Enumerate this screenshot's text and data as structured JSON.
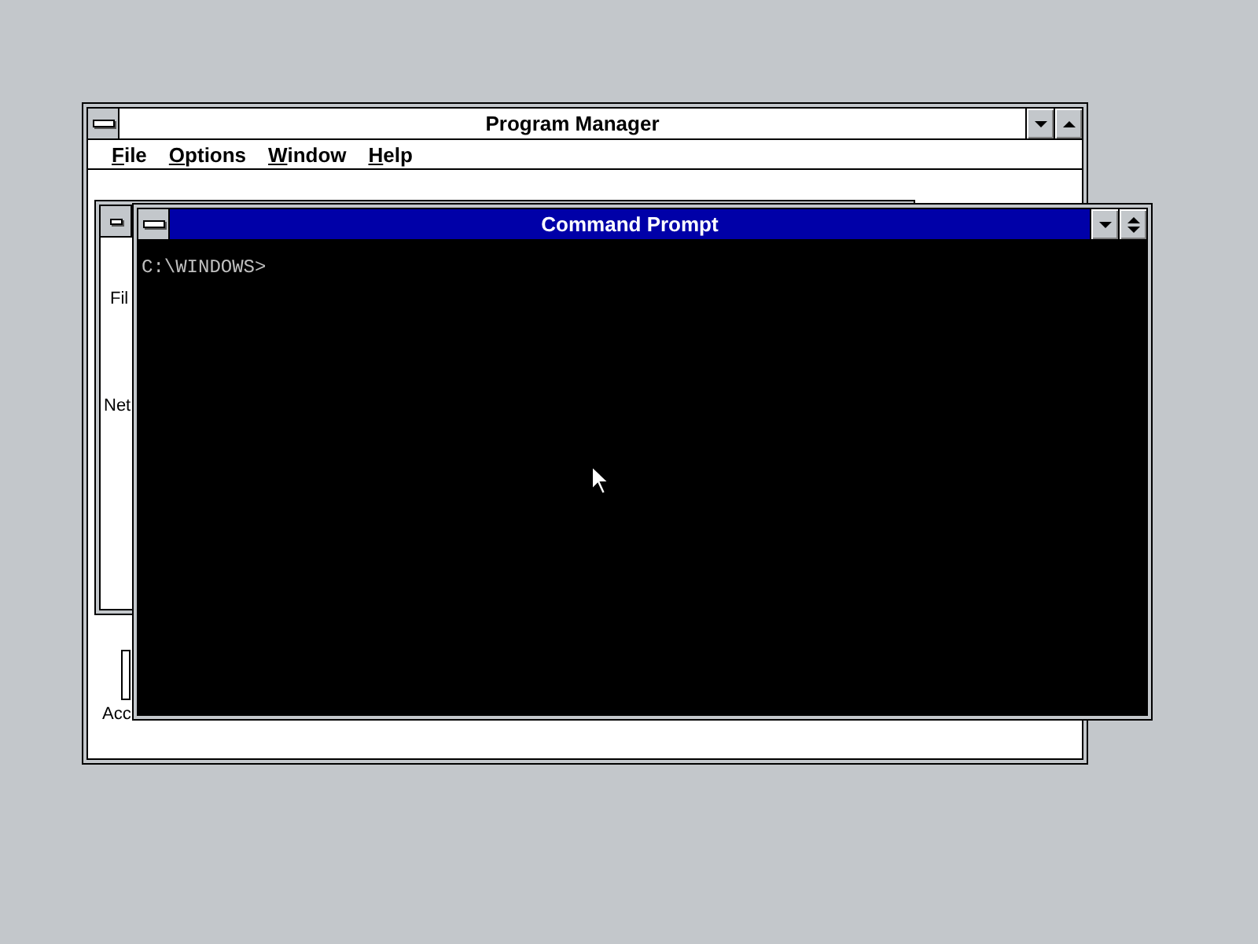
{
  "program_manager": {
    "title": "Program Manager",
    "active": false,
    "menu": [
      {
        "label": "File"
      },
      {
        "label": "Options"
      },
      {
        "label": "Window"
      },
      {
        "label": "Help"
      }
    ],
    "group_window": {
      "labels": [
        "Fil",
        "Net"
      ]
    },
    "icons": [
      {
        "label": "Acc"
      }
    ]
  },
  "command_prompt": {
    "title": "Command Prompt",
    "active": true,
    "lines": [
      "C:\\WINDOWS>"
    ]
  }
}
